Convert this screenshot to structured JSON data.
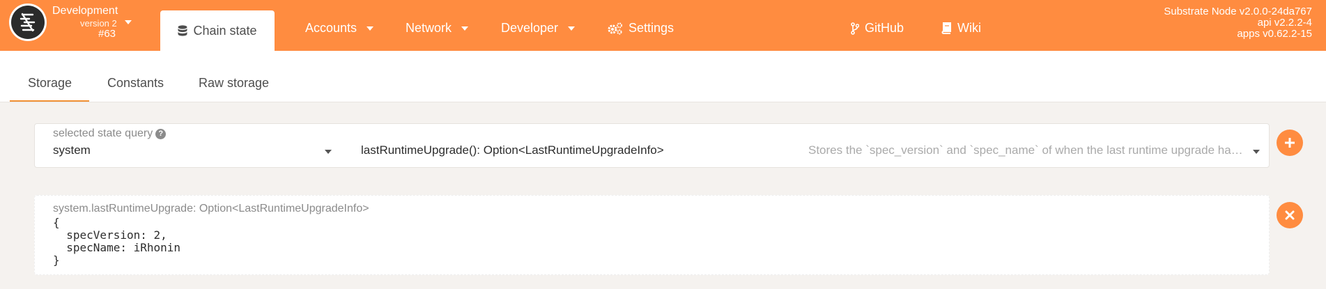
{
  "header": {
    "chain_name": "Development",
    "chain_version": "version 2",
    "chain_block": "#63",
    "tabs": {
      "chain_state": "Chain state",
      "accounts": "Accounts",
      "network": "Network",
      "developer": "Developer",
      "settings": "Settings",
      "github": "GitHub",
      "wiki": "Wiki"
    },
    "version_info": {
      "node": "Substrate Node v2.0.0-24da767",
      "api": "api v2.2.2-4",
      "apps": "apps v0.62.2-15"
    }
  },
  "subtabs": {
    "storage": "Storage",
    "constants": "Constants",
    "raw_storage": "Raw storage"
  },
  "query": {
    "label": "selected state query",
    "section": "system",
    "method": "lastRuntimeUpgrade(): Option<LastRuntimeUpgradeInfo>",
    "doc": "Stores the `spec_version` and `spec_name` of when the last runtime upgrade happened."
  },
  "result": {
    "label": "system.lastRuntimeUpgrade: Option<LastRuntimeUpgradeInfo>",
    "body": "{\n  specVersion: 2,\n  specName: iRhonin\n}"
  },
  "colors": {
    "accent": "#ff8c40",
    "background": "#f5f2ef"
  }
}
